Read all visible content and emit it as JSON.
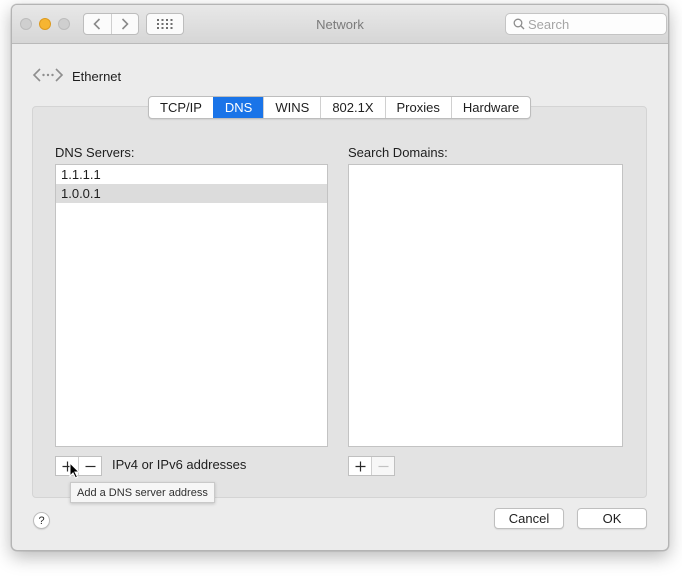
{
  "window": {
    "title": "Network"
  },
  "toolbar": {
    "search_placeholder": "Search",
    "back_icon": "chevron-left-icon",
    "forward_icon": "chevron-right-icon",
    "show_all_icon": "grid-icon"
  },
  "breadcrumb": {
    "label": "Ethernet",
    "icon": "ethernet-icon"
  },
  "tabs": [
    {
      "label": "TCP/IP",
      "active": false
    },
    {
      "label": "DNS",
      "active": true
    },
    {
      "label": "WINS",
      "active": false
    },
    {
      "label": "802.1X",
      "active": false
    },
    {
      "label": "Proxies",
      "active": false
    },
    {
      "label": "Hardware",
      "active": false
    }
  ],
  "dns": {
    "servers_label": "DNS Servers:",
    "servers": [
      {
        "value": "1.1.1.1",
        "selected": false
      },
      {
        "value": "1.0.0.1",
        "selected": true
      }
    ],
    "hint": "IPv4 or IPv6 addresses",
    "tooltip": "Add a DNS server address"
  },
  "search_domains": {
    "label": "Search Domains:",
    "items": []
  },
  "buttons": {
    "help": "?",
    "cancel": "Cancel",
    "ok": "OK"
  },
  "colors": {
    "accent": "#1a74e8",
    "minimize_light": "#f6b532",
    "selected_row": "#dcdcdc"
  }
}
